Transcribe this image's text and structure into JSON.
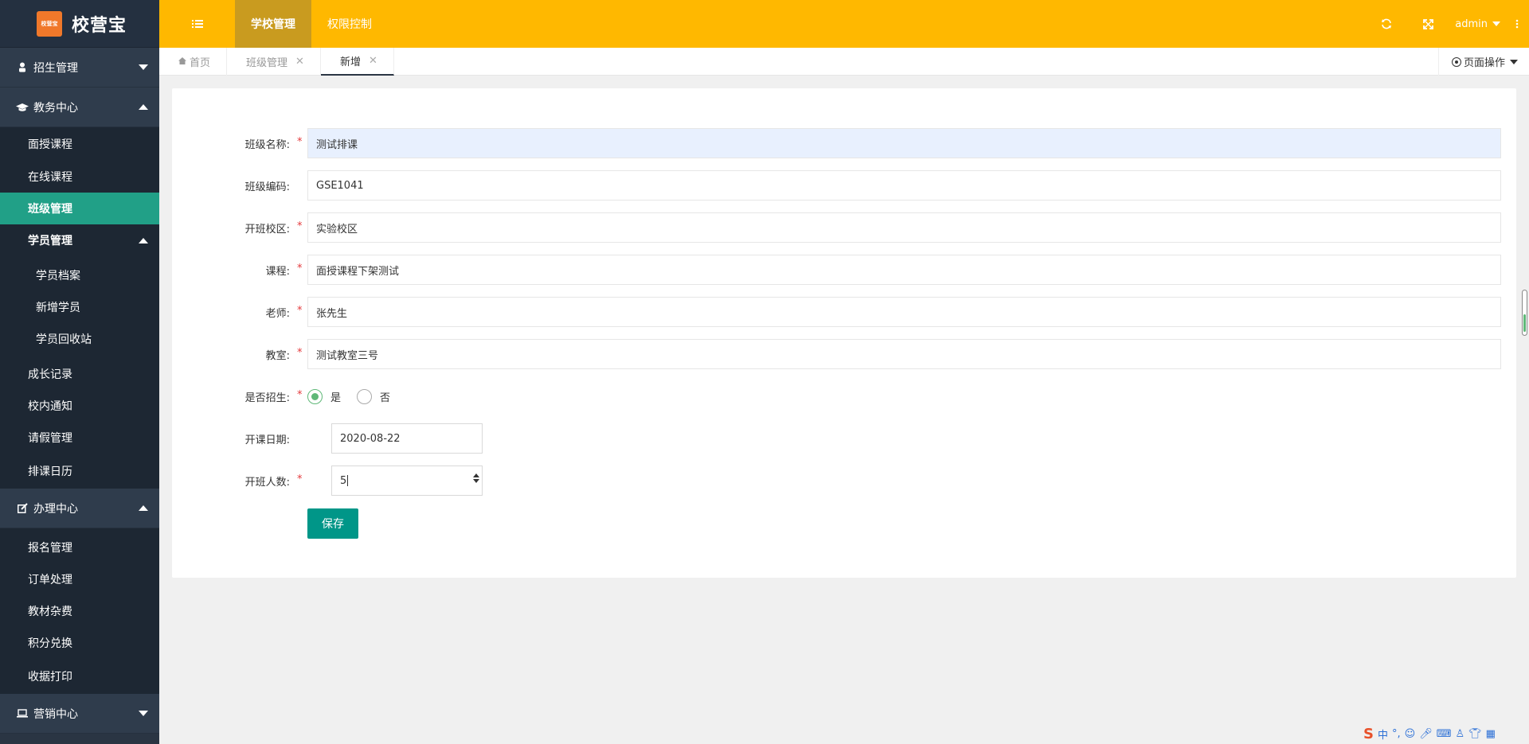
{
  "brand": {
    "logo_text": "校营宝",
    "logo_icon_text": "校营宝"
  },
  "sidebar": {
    "groups": [
      {
        "label": "招生管理",
        "icon": "user-icon",
        "expanded": false
      },
      {
        "label": "教务中心",
        "icon": "graduation-cap-icon",
        "expanded": true,
        "items": [
          "面授课程",
          "在线课程",
          "班级管理",
          "学员管理",
          "学员档案",
          "新增学员",
          "学员回收站",
          "成长记录",
          "校内通知",
          "请假管理",
          "排课日历"
        ]
      },
      {
        "label": "办理中心",
        "icon": "edit-icon",
        "expanded": true,
        "items": [
          "报名管理",
          "订单处理",
          "教材杂费",
          "积分兑换",
          "收据打印"
        ]
      },
      {
        "label": "营销中心",
        "icon": "laptop-icon",
        "expanded": false
      }
    ],
    "active_item": "班级管理"
  },
  "topbar": {
    "tabs": [
      "学校管理",
      "权限控制"
    ],
    "active_tab": "学校管理",
    "user": "admin"
  },
  "page_tabs": {
    "items": [
      {
        "label": "首页",
        "closable": false
      },
      {
        "label": "班级管理",
        "closable": true
      },
      {
        "label": "新增",
        "closable": true
      }
    ],
    "active": "新增",
    "ops_label": "页面操作"
  },
  "form": {
    "class_name": {
      "label": "班级名称:",
      "value": "测试排课",
      "required": true
    },
    "class_code": {
      "label": "班级编码:",
      "value": "GSE1041",
      "required": false
    },
    "campus": {
      "label": "开班校区:",
      "value": "实验校区",
      "required": true
    },
    "course": {
      "label": "课程:",
      "value": "面授课程下架测试",
      "required": true
    },
    "teacher": {
      "label": "老师:",
      "value": "张先生",
      "required": true
    },
    "classroom": {
      "label": "教室:",
      "value": "测试教室三号",
      "required": true
    },
    "enrolling": {
      "label": "是否招生:",
      "options": [
        "是",
        "否"
      ],
      "selected": "是",
      "required": true
    },
    "start_date": {
      "label": "开课日期:",
      "value": "2020-08-22",
      "required": false
    },
    "capacity": {
      "label": "开班人数:",
      "value": "5",
      "required": true
    },
    "save_label": "保存"
  },
  "colors": {
    "topbar": "#ffb800",
    "sidebar": "#2a3543",
    "active_item": "#21a087",
    "save_button": "#009688",
    "required": "#e4393c"
  }
}
